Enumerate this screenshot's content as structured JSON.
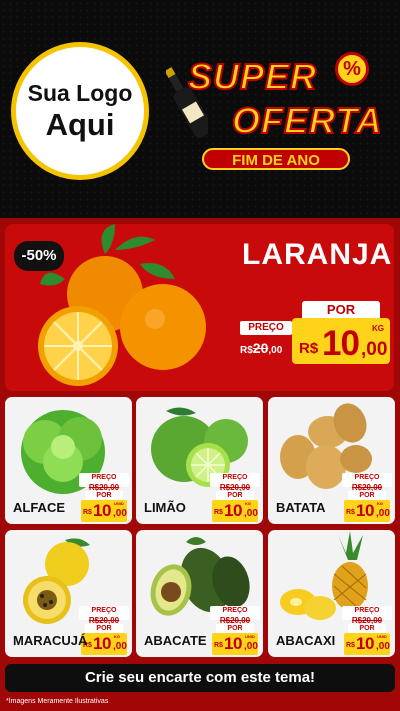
{
  "logo": {
    "line1": "Sua Logo",
    "line2": "Aqui"
  },
  "title": {
    "super": "SUPER",
    "oferta": "OFERTA",
    "percent": "%",
    "subtitle": "FIM DE ANO"
  },
  "featured": {
    "discount": "-50%",
    "name": "LARANJA",
    "preco_label": "PREÇO",
    "old_currency": "R$",
    "old_int": "20",
    "old_dec": ",00",
    "por_label": "POR",
    "currency": "R$",
    "price_int": "10",
    "price_dec": ",00",
    "unit": "KG"
  },
  "products": [
    {
      "name": "ALFACE",
      "preco_label": "PREÇO",
      "old": "R$20,00",
      "por_label": "POR",
      "currency": "R$",
      "price_int": "10",
      "price_dec": ",00",
      "unit": "UNID"
    },
    {
      "name": "LIMÃO",
      "preco_label": "PREÇO",
      "old": "R$20,00",
      "por_label": "POR",
      "currency": "R$",
      "price_int": "10",
      "price_dec": ",00",
      "unit": "KG"
    },
    {
      "name": "BATATA",
      "preco_label": "PREÇO",
      "old": "R$20,00",
      "por_label": "POR",
      "currency": "R$",
      "price_int": "10",
      "price_dec": ",00",
      "unit": "KG"
    },
    {
      "name": "MARACUJÁ",
      "preco_label": "PREÇO",
      "old": "R$20,00",
      "por_label": "POR",
      "currency": "R$",
      "price_int": "10",
      "price_dec": ",00",
      "unit": "KG"
    },
    {
      "name": "ABACATE",
      "preco_label": "PREÇO",
      "old": "R$20,00",
      "por_label": "POR",
      "currency": "R$",
      "price_int": "10",
      "price_dec": ",00",
      "unit": "UNID"
    },
    {
      "name": "ABACAXI",
      "preco_label": "PREÇO",
      "old": "R$20,00",
      "por_label": "POR",
      "currency": "R$",
      "price_int": "10",
      "price_dec": ",00",
      "unit": "UNID"
    }
  ],
  "footer": {
    "cta": "Crie seu encarte com este tema!",
    "note": "*Imagens Meramente Ilustrativas"
  },
  "colors": {
    "red": "#c90a0a",
    "dark_red": "#a00808",
    "yellow": "#ffd31a",
    "black": "#0b0b0b"
  }
}
